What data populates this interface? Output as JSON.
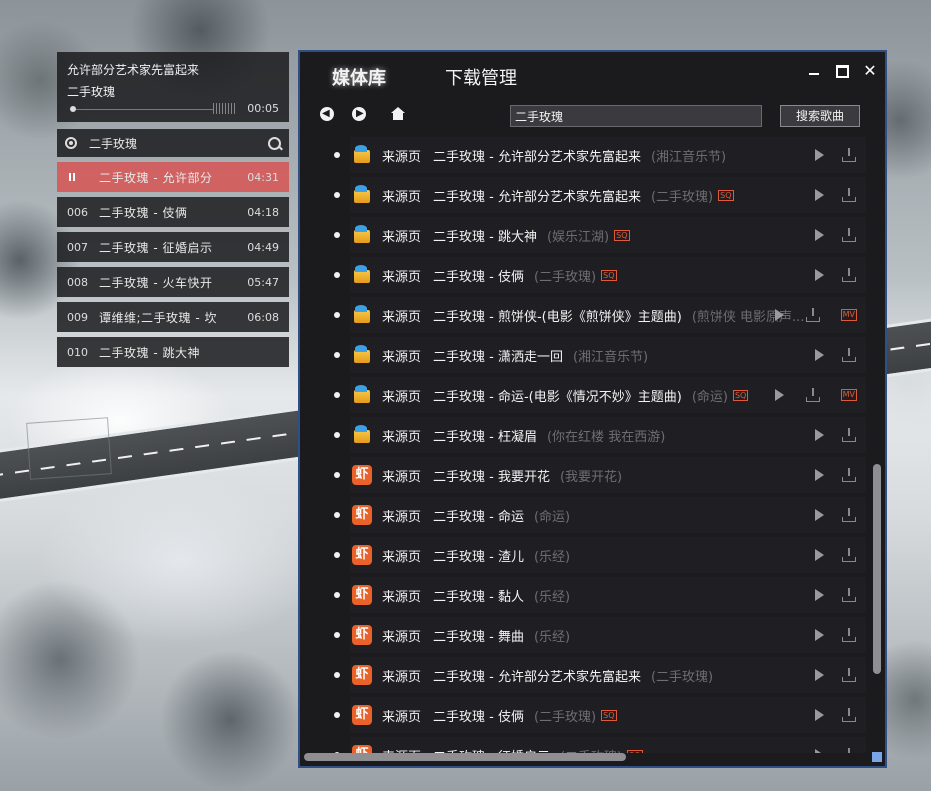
{
  "mini_player": {
    "now_playing_title": "允许部分艺术家先富起来",
    "now_playing_artist": "二手玫瑰",
    "progress_fraction": 0.02,
    "elapsed_time": "00:05",
    "search_query": "二手玫瑰",
    "playlist": [
      {
        "no": "",
        "name": "二手玫瑰 - 允许部分",
        "duration": "04:31",
        "active": true
      },
      {
        "no": "006",
        "name": "二手玫瑰 - 伎俩",
        "duration": "04:18"
      },
      {
        "no": "007",
        "name": "二手玫瑰 - 征婚启示",
        "duration": "04:49"
      },
      {
        "no": "008",
        "name": "二手玫瑰 - 火车快开",
        "duration": "05:47"
      },
      {
        "no": "009",
        "name": "谭维维;二手玫瑰 - 坎",
        "duration": "06:08"
      },
      {
        "no": "010",
        "name": "二手玫瑰 - 跳大神",
        "duration": ""
      }
    ]
  },
  "window": {
    "tabs": {
      "library": "媒体库",
      "download": "下载管理"
    },
    "controls": {
      "close": "✕"
    },
    "search": {
      "value": "二手玫瑰",
      "button": "搜索歌曲"
    },
    "results": [
      {
        "icon": "box",
        "source": "来源页",
        "title": "二手玫瑰 - 允许部分艺术家先富起来",
        "album": "(湘江音乐节)",
        "sq": false,
        "mv": false
      },
      {
        "icon": "box",
        "source": "来源页",
        "title": "二手玫瑰 - 允许部分艺术家先富起来",
        "album": "(二手玫瑰)",
        "sq": true,
        "mv": false
      },
      {
        "icon": "box",
        "source": "来源页",
        "title": "二手玫瑰 - 跳大神",
        "album": "(娱乐江湖)",
        "sq": true,
        "mv": false
      },
      {
        "icon": "box",
        "source": "来源页",
        "title": "二手玫瑰 - 伎俩",
        "album": "(二手玫瑰)",
        "sq": true,
        "mv": false
      },
      {
        "icon": "box",
        "source": "来源页",
        "title": "二手玫瑰 - 煎饼侠-(电影《煎饼侠》主题曲)",
        "album": "(煎饼侠 电影原声...",
        "sq": false,
        "mv": true
      },
      {
        "icon": "box",
        "source": "来源页",
        "title": "二手玫瑰 - 潇洒走一回",
        "album": "(湘江音乐节)",
        "sq": false,
        "mv": false
      },
      {
        "icon": "box",
        "source": "来源页",
        "title": "二手玫瑰 - 命运-(电影《情况不妙》主题曲)",
        "album": "(命运)",
        "sq": true,
        "mv": true
      },
      {
        "icon": "box",
        "source": "来源页",
        "title": "二手玫瑰 - 枉凝眉",
        "album": "(你在红楼 我在西游)",
        "sq": false,
        "mv": false
      },
      {
        "icon": "xia",
        "source": "来源页",
        "title": "二手玫瑰 - 我要开花",
        "album": "(我要开花)",
        "sq": false,
        "mv": false
      },
      {
        "icon": "xia",
        "source": "来源页",
        "title": "二手玫瑰 - 命运",
        "album": "(命运)",
        "sq": false,
        "mv": false
      },
      {
        "icon": "xia",
        "source": "来源页",
        "title": "二手玫瑰 - 渣儿",
        "album": "(乐经)",
        "sq": false,
        "mv": false
      },
      {
        "icon": "xia",
        "source": "来源页",
        "title": "二手玫瑰 - 黏人",
        "album": "(乐经)",
        "sq": false,
        "mv": false
      },
      {
        "icon": "xia",
        "source": "来源页",
        "title": "二手玫瑰 - 舞曲",
        "album": "(乐经)",
        "sq": false,
        "mv": false
      },
      {
        "icon": "xia",
        "source": "来源页",
        "title": "二手玫瑰 - 允许部分艺术家先富起来",
        "album": "(二手玫瑰)",
        "sq": false,
        "mv": false
      },
      {
        "icon": "xia",
        "source": "来源页",
        "title": "二手玫瑰 - 伎俩",
        "album": "(二手玫瑰)",
        "sq": true,
        "mv": false
      },
      {
        "icon": "xia",
        "source": "来源页",
        "title": "二手玫瑰 - 征婚启示",
        "album": "(二手玫瑰)",
        "sq": true,
        "mv": false
      }
    ],
    "badge_sq": "SQ",
    "badge_mv": "MV",
    "xia_glyph": "虾",
    "accent_color": "#2f4f86",
    "active_row_color": "#d65656"
  }
}
